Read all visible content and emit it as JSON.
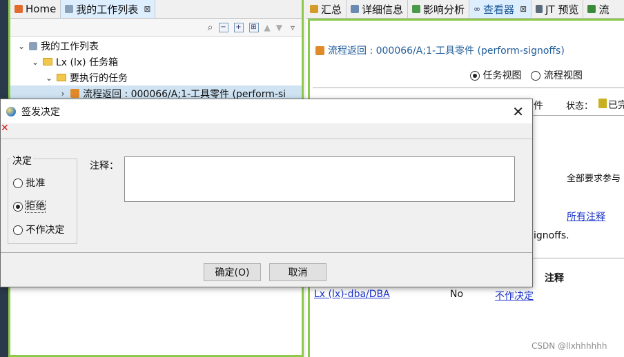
{
  "left_tabs": [
    {
      "label": "Home",
      "icon": "home-icon"
    },
    {
      "label": "我的工作列表",
      "icon": "worklist-icon",
      "close": "⊠"
    }
  ],
  "tree": [
    {
      "label": "我的工作列表",
      "indent": 0,
      "chevron": "⌄"
    },
    {
      "label": "Lx (lx) 任务箱",
      "indent": 1,
      "chevron": "⌄"
    },
    {
      "label": "要执行的任务",
      "indent": 2,
      "chevron": "⌄"
    },
    {
      "label": "流程返回 : 000066/A;1-工具零件 (perform-si",
      "indent": 3,
      "chevron": "›"
    }
  ],
  "right_tabs": [
    "汇总",
    "详细信息",
    "影响分析",
    "查看器",
    "JT 预览",
    "流"
  ],
  "viewer": {
    "process_title": "流程返回 : 000066/A;1-工具零件 (perform-signoffs)",
    "task_view": "任务视图",
    "process_view": "流程视图",
    "col_hint": "件",
    "status_label": "状态：",
    "status_value": "已完",
    "all_required": "全部要求参与",
    "all_comments": "所有注释",
    "signoffs_text": "ignoffs.",
    "comment_header": "注释",
    "row_user": "Lx (lx)-dba/DBA",
    "row_value": "No",
    "row_decision": "不作决定"
  },
  "dialog": {
    "title": "签发决定",
    "decision_group": "决定",
    "options": [
      "批准",
      "拒绝",
      "不作决定"
    ],
    "selected": "拒绝",
    "comment_label": "注释：",
    "comment_value": "",
    "ok": "确定(O)",
    "cancel": "取消"
  },
  "watermark": "CSDN @llxhhhhhh"
}
